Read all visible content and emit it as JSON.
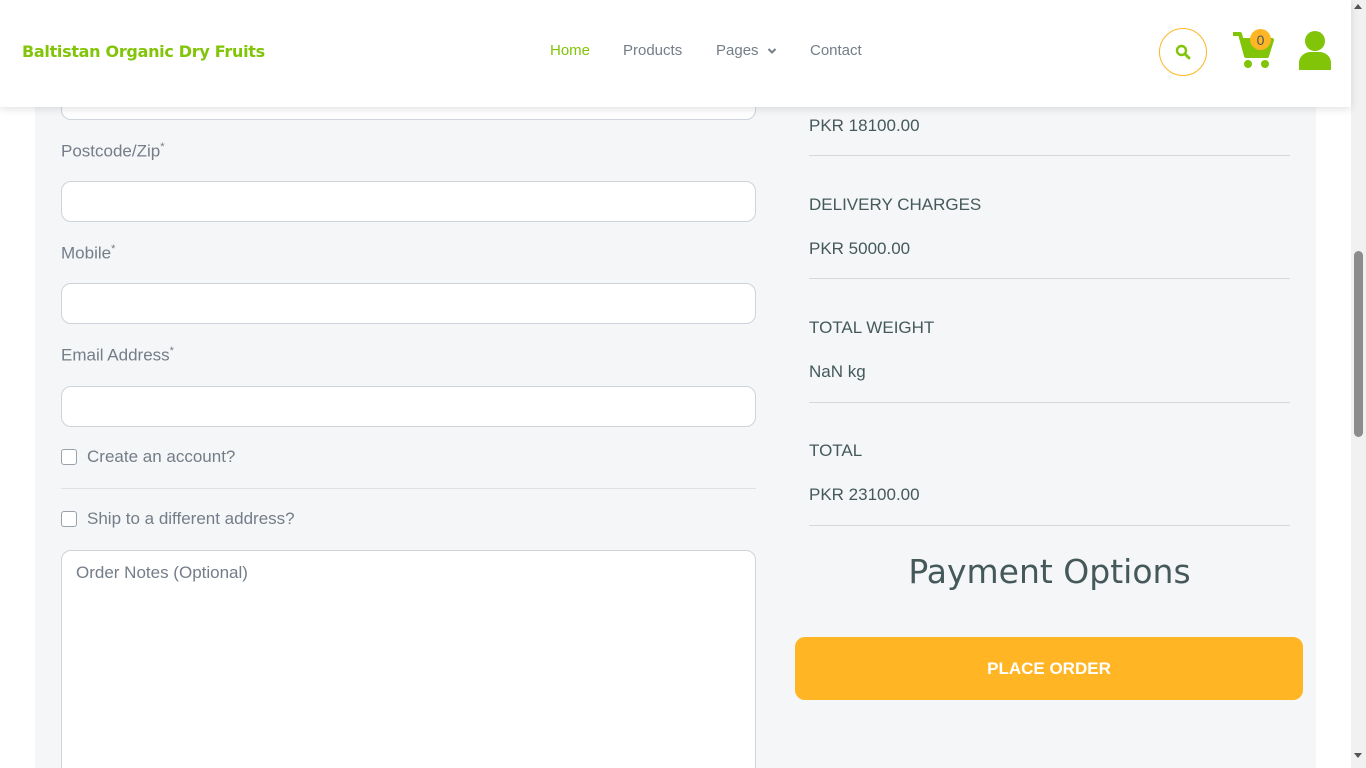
{
  "header": {
    "brand": "Baltistan Organic Dry Fruits",
    "nav": {
      "home": "Home",
      "products": "Products",
      "pages": "Pages",
      "contact": "Contact"
    },
    "cart_count": "0",
    "colors": {
      "brand": "#81c408",
      "accent": "#ffb524",
      "text": "#45595b",
      "muted": "#747d88"
    }
  },
  "form": {
    "postcode_label": "Postcode/Zip",
    "mobile_label": "Mobile",
    "email_label": "Email Address",
    "required_mark": "*",
    "create_account_label": "Create an account?",
    "ship_different_label": "Ship to a different address?",
    "order_notes_placeholder": "Order Notes (Optional)"
  },
  "summary": {
    "subtotal_value": "PKR 18100.00",
    "delivery_label": "DELIVERY CHARGES",
    "delivery_value": "PKR 5000.00",
    "weight_label": "TOTAL WEIGHT",
    "weight_value": "NaN kg",
    "total_label": "TOTAL",
    "total_value": "PKR 23100.00",
    "payment_title": "Payment Options",
    "place_order_label": "PLACE ORDER"
  }
}
